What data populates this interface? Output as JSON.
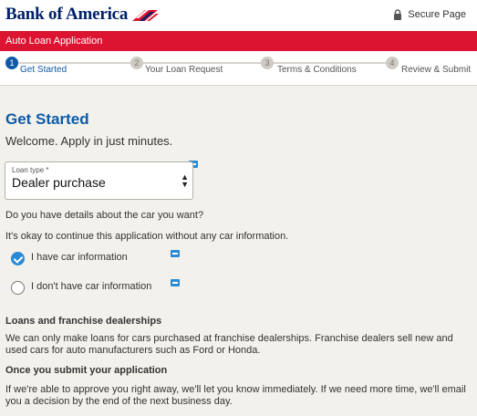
{
  "header": {
    "logo_text": "Bank of America",
    "secure_label": "Secure Page"
  },
  "banner": {
    "title": "Auto Loan Application"
  },
  "steps": [
    {
      "num": "1",
      "label": "Get Started",
      "active": true
    },
    {
      "num": "2",
      "label": "Your Loan Request",
      "active": false
    },
    {
      "num": "3",
      "label": "Terms & Conditions",
      "active": false
    },
    {
      "num": "4",
      "label": "Review & Submit",
      "active": false
    }
  ],
  "main": {
    "title": "Get Started",
    "welcome": "Welcome. Apply in just minutes.",
    "loan_type": {
      "label": "Loan type *",
      "value": "Dealer purchase"
    },
    "question": "Do you have details about the car you want?",
    "okay_text": "It's okay to continue this application without any car information.",
    "options": [
      {
        "label": "I have car information",
        "checked": true
      },
      {
        "label": "I don't have car information",
        "checked": false
      }
    ],
    "section1": {
      "heading": "Loans and franchise dealerships",
      "text": "We can only make loans for cars purchased at franchise dealerships. Franchise dealers sell new and used cars for auto manufacturers such as Ford or Honda."
    },
    "section2": {
      "heading": "Once you submit your application",
      "text": "If we're able to approve you right away, we'll let you know immediately. If we need more time, we'll email you a decision by the end of the next business day."
    }
  },
  "colors": {
    "brand_red": "#dc1431",
    "brand_blue": "#012169",
    "accent_blue": "#0e5aa7"
  }
}
